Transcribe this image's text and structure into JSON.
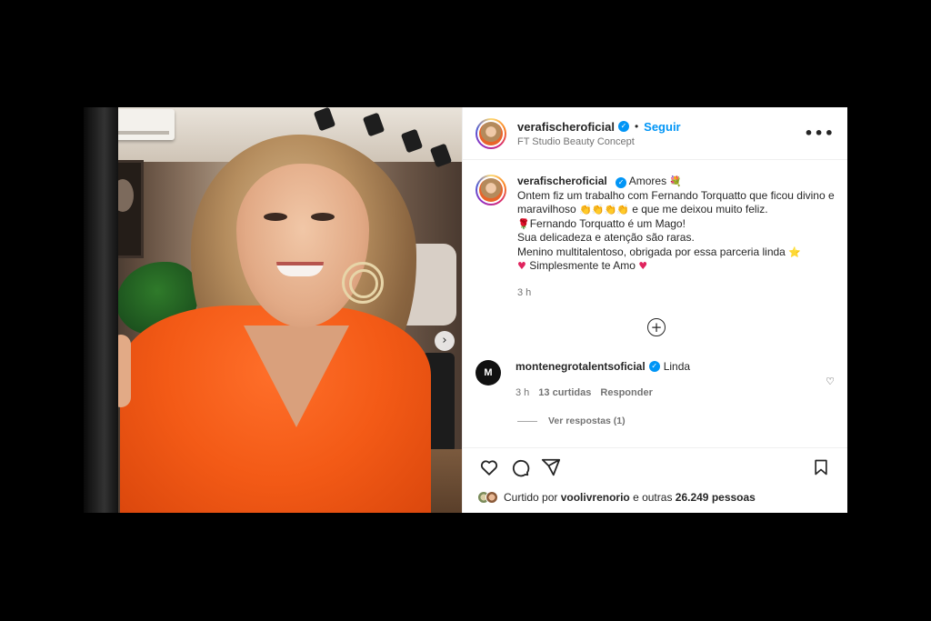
{
  "post": {
    "username": "verafischeroficial",
    "follow_label": "Seguir",
    "location": "FT Studio Beauty Concept",
    "more_label": "•••",
    "next_label": "›"
  },
  "caption": {
    "username": "verafischeroficial",
    "line1_text": "Amores",
    "line1_emoji": "💐",
    "line2": "Ontem fiz um trabalho com Fernando Torquatto que ficou divino e",
    "line3_a": "maravilhoso",
    "line3_emojis": "👏👏👏👏",
    "line3_b": "e que me deixou muito feliz.",
    "line4_emoji": "🌹",
    "line4": "Fernando Torquatto é um Mago!",
    "line5": "Sua delicadeza e atenção são raras.",
    "line6": "Menino multitalentoso, obrigada por essa parceria linda",
    "line6_emoji": "⭐",
    "line7_heart1": "♥",
    "line7": "Simplesmente te Amo",
    "line7_heart2": "♥",
    "time": "3 h"
  },
  "load_more_label": "+",
  "comment": {
    "avatar_text": "M",
    "username": "montenegrotalentsoficial",
    "text": "Linda",
    "time": "3 h",
    "likes": "13 curtidas",
    "reply_label": "Responder",
    "heart": "♡",
    "view_replies": "Ver respostas (1)"
  },
  "likes": {
    "prefix": "Curtido por",
    "user": "voolivrenorio",
    "suffix": "e outras",
    "count": "26.249 pessoas"
  },
  "colors": {
    "accent": "#0095f6",
    "text": "#262626",
    "muted": "#737373",
    "background": "#000000"
  }
}
